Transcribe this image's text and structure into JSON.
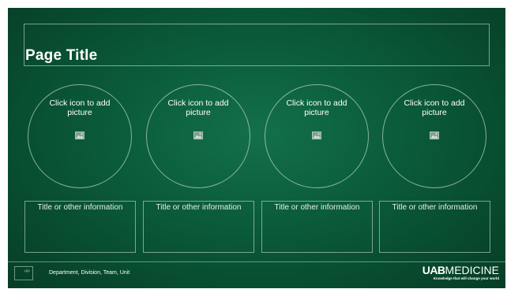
{
  "slide": {
    "title": "Page Title",
    "picture_placeholders": [
      {
        "label": "Click icon to add picture",
        "icon": "picture-icon"
      },
      {
        "label": "Click icon to add picture",
        "icon": "picture-icon"
      },
      {
        "label": "Click icon to add picture",
        "icon": "picture-icon"
      },
      {
        "label": "Click icon to add picture",
        "icon": "picture-icon"
      }
    ],
    "info_boxes": [
      {
        "label": "Title or other information"
      },
      {
        "label": "Title or other information"
      },
      {
        "label": "Title or other information"
      },
      {
        "label": "Title or other information"
      }
    ]
  },
  "footer": {
    "slide_number": "‹#›",
    "text": "Department, Division, Team, Unit"
  },
  "logo": {
    "brand_prefix": "UAB",
    "brand_suffix": "MEDICINE",
    "tagline": "Knowledge that will change your world"
  },
  "colors": {
    "background": "#0a5a38",
    "background_center": "#13704a",
    "text": "#ffffff",
    "outline": "#dcebdc"
  }
}
